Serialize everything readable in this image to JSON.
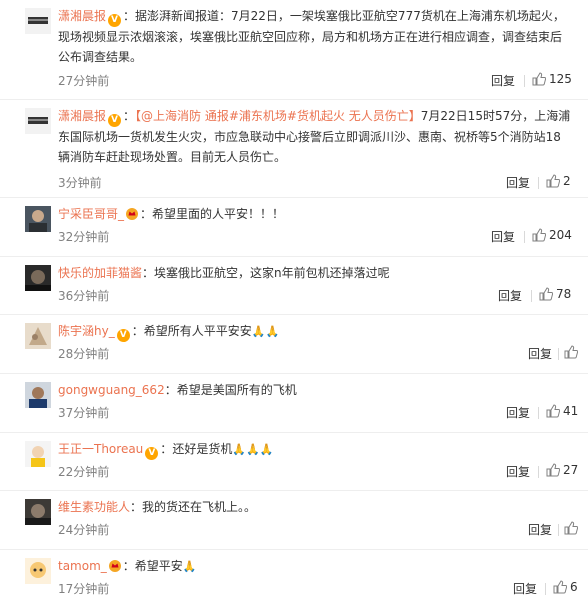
{
  "comments": [
    {
      "username": "潇湘晨报",
      "badge": "V",
      "sep": "：",
      "text": "据澎湃新闻报道：7月22日，一架埃塞俄比亚航空777货机在上海浦东机场起火，现场视频显示浓烟滚滚，埃塞俄比亚航空回应称，局方和机场方正在进行相应调查，调查结束后公布调查结果。",
      "time": "27分钟前",
      "reply": "回复",
      "likes": "125"
    },
    {
      "username": "潇湘晨报",
      "badge": "V",
      "sep": "：",
      "link_text": "【@上海消防 通报#浦东机场#货机起火 无人员伤亡】",
      "text": "7月22日15时57分，上海浦东国际机场一货机发生火灾，市应急联动中心接警后立即调派川沙、惠南、祝桥等5个消防站18辆消防车赶赴现场处置。目前无人员伤亡。",
      "time": "3分钟前",
      "reply": "回复",
      "likes": "2"
    },
    {
      "username": "宁采臣哥哥_",
      "sep": "：",
      "text": "希望里面的人平安！！！",
      "time": "32分钟前",
      "reply": "回复",
      "likes": "204"
    },
    {
      "username": "快乐的加菲猫酱",
      "sep": "：",
      "text": "埃塞俄比亚航空，这家n年前包机还掉落过呢",
      "time": "36分钟前",
      "reply": "回复",
      "likes": "78"
    },
    {
      "username": "陈宇涵hy_",
      "badge": "V",
      "sep": "：",
      "text": "希望所有人平平安安",
      "emoji": "🙏🙏",
      "time": "28分钟前",
      "reply": "回复",
      "likes": ""
    },
    {
      "username": "gongwguang_662",
      "sep": "：",
      "text": "希望是美国所有的飞机",
      "time": "37分钟前",
      "reply": "回复",
      "likes": "41"
    },
    {
      "username": "王正一Thoreau",
      "badge": "V",
      "sep": "：",
      "text": "还好是货机",
      "emoji": "🙏🙏🙏",
      "time": "22分钟前",
      "reply": "回复",
      "likes": "27"
    },
    {
      "username": "维生素功能人",
      "sep": "：",
      "text": "我的货还在飞机上。。",
      "time": "24分钟前",
      "reply": "回复",
      "likes": ""
    },
    {
      "username": "tamom_",
      "sep": "：",
      "text": "希望平安",
      "emoji": "🙏",
      "time": "17分钟前",
      "reply": "回复",
      "likes": "6"
    }
  ],
  "colors": {
    "username": "#eb7350",
    "vbadge": "#ffa500",
    "meta": "#808080",
    "divider": "#eeeeee"
  },
  "icons": {
    "like": "thumbs-up-icon",
    "verified": "verified-v-icon",
    "crown": "crown-icon"
  }
}
